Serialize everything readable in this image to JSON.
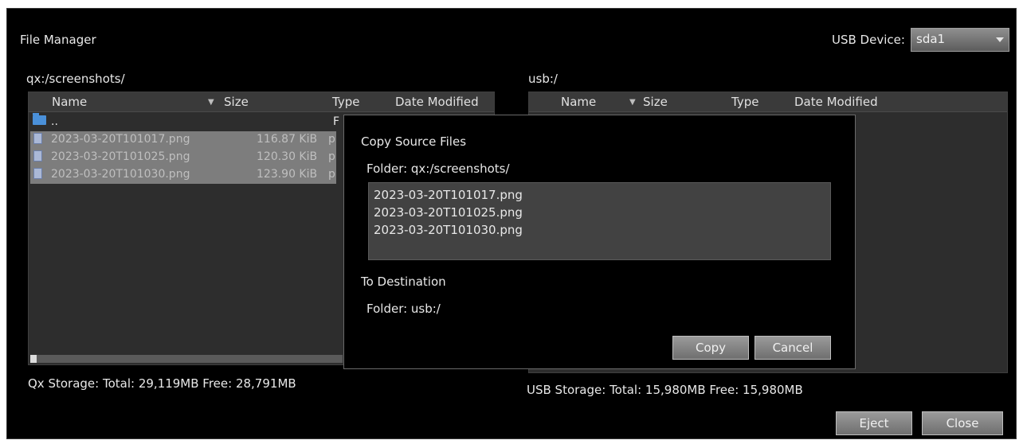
{
  "window": {
    "title": "File Manager"
  },
  "usb_device": {
    "label": "USB Device:",
    "value": "sda1"
  },
  "left_pane": {
    "path": "qx:/screenshots/",
    "columns": {
      "name": "Name",
      "size": "Size",
      "type": "Type",
      "date": "Date Modified"
    },
    "rows": [
      {
        "name": "..",
        "size": "",
        "type": "F",
        "selected": false,
        "kind": "folder"
      },
      {
        "name": "2023-03-20T101017.png",
        "size": "116.87 KiB",
        "type": "p",
        "selected": true,
        "kind": "file"
      },
      {
        "name": "2023-03-20T101025.png",
        "size": "120.30 KiB",
        "type": "p",
        "selected": true,
        "kind": "file"
      },
      {
        "name": "2023-03-20T101030.png",
        "size": "123.90 KiB",
        "type": "p",
        "selected": true,
        "kind": "file"
      }
    ],
    "storage": "Qx Storage: Total: 29,119MB Free: 28,791MB"
  },
  "right_pane": {
    "path": "usb:/",
    "columns": {
      "name": "Name",
      "size": "Size",
      "type": "Type",
      "date": "Date Modified"
    },
    "storage": "USB Storage: Total: 15,980MB Free: 15,980MB"
  },
  "dialog": {
    "title": "Copy Source Files",
    "source_folder": "Folder: qx:/screenshots/",
    "files": [
      "2023-03-20T101017.png",
      "2023-03-20T101025.png",
      "2023-03-20T101030.png"
    ],
    "dest_title": "To Destination",
    "dest_folder": "Folder: usb:/",
    "copy_label": "Copy",
    "cancel_label": "Cancel"
  },
  "footer": {
    "eject_label": "Eject",
    "close_label": "Close"
  }
}
